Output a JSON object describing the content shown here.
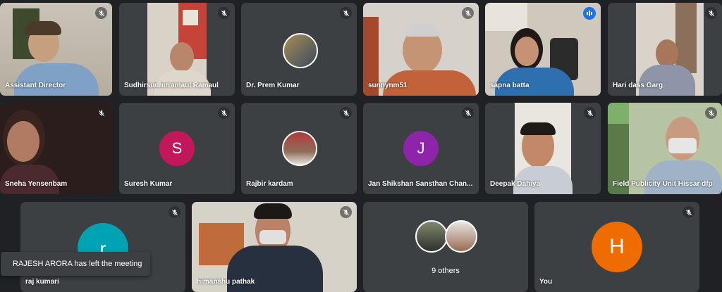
{
  "participants": [
    {
      "name": "Assistant Director"
    },
    {
      "name": "Sudhirsudhirramaul Ramaul"
    },
    {
      "name": "Dr. Prem Kumar"
    },
    {
      "name": "sunnynm51"
    },
    {
      "name": "sapna batta"
    },
    {
      "name": "Hari dass Garg"
    },
    {
      "name": "Sneha Yensenbam"
    },
    {
      "name": "Suresh Kumar",
      "initial": "S",
      "color": "#c2185b"
    },
    {
      "name": "Rajbir kardam"
    },
    {
      "name": "Jan Shikshan Sansthan Chan...",
      "initial": "J",
      "color": "#8e24aa"
    },
    {
      "name": "Deepak Dahiya"
    },
    {
      "name": "Field Publicity Unit Hissar dfp"
    },
    {
      "name": "raj kumari",
      "initial": "r",
      "color": "#00a3b4"
    },
    {
      "name": "himanshu pathak"
    },
    {
      "name": "9 others"
    },
    {
      "name": "You",
      "initial": "H",
      "color": "#ef6c00"
    }
  ],
  "toast": {
    "message": "RAJESH ARORA has left the meeting"
  },
  "icons": {
    "mic_off": "mic-off-icon",
    "speaking": "audio-level-icon"
  }
}
